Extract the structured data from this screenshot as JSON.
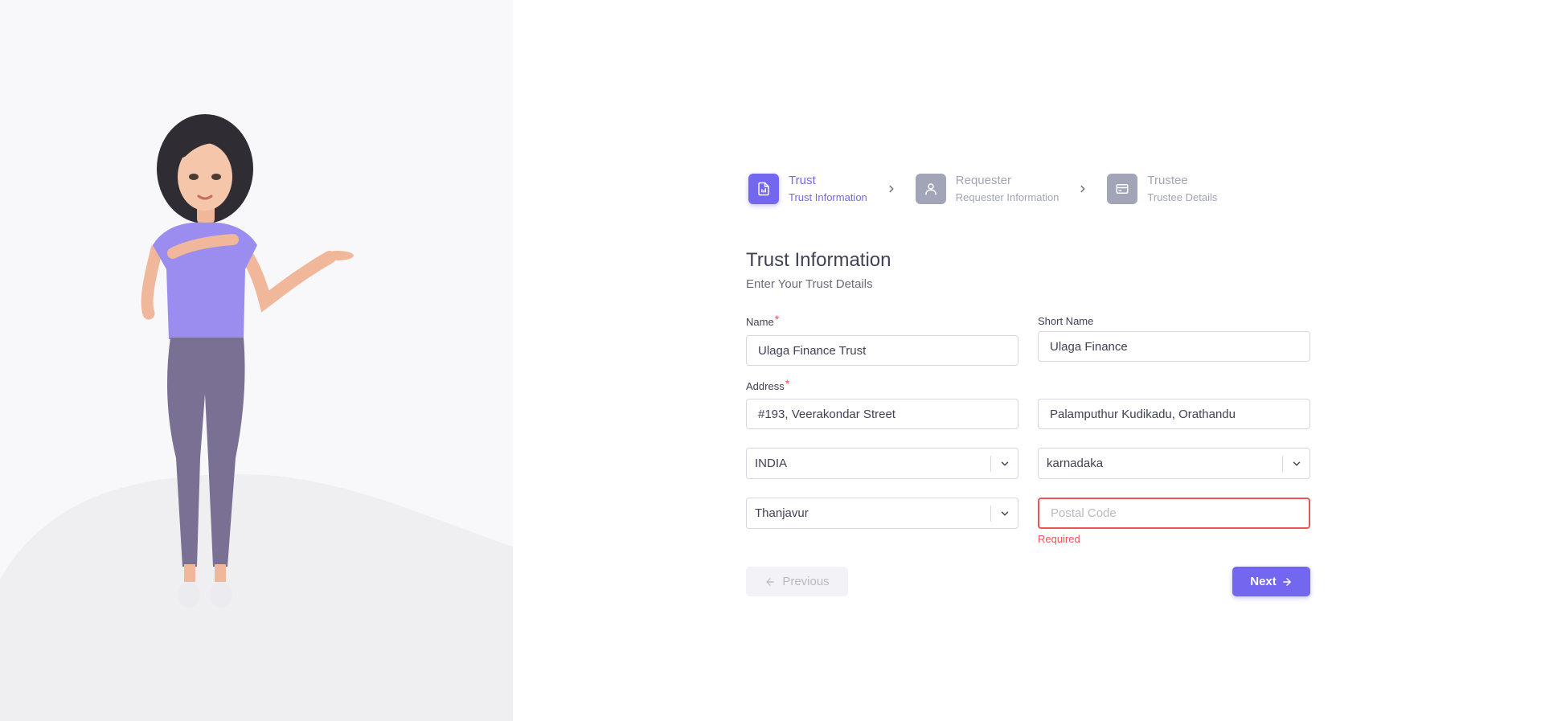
{
  "stepper": {
    "steps": [
      {
        "title": "Trust",
        "subtitle": "Trust Information",
        "icon": "file-icon",
        "active": true
      },
      {
        "title": "Requester",
        "subtitle": "Requester Information",
        "icon": "user-icon",
        "active": false
      },
      {
        "title": "Trustee",
        "subtitle": "Trustee Details",
        "icon": "card-icon",
        "active": false
      }
    ]
  },
  "form": {
    "title": "Trust Information",
    "subtitle": "Enter Your Trust Details",
    "name": {
      "label": "Name",
      "required_mark": "*",
      "value": "Ulaga Finance Trust"
    },
    "short_name": {
      "label": "Short Name",
      "value": "Ulaga Finance"
    },
    "address": {
      "label": "Address",
      "required_mark": "*",
      "line1": "#193, Veerakondar Street",
      "line2": "Palamputhur Kudikadu, Orathandu"
    },
    "country": {
      "value": "INDIA"
    },
    "state": {
      "value": "karnadaka"
    },
    "city": {
      "value": "Thanjavur"
    },
    "postal_code": {
      "placeholder": "Postal Code",
      "value": "",
      "error": "Required"
    }
  },
  "buttons": {
    "previous": "Previous",
    "next": "Next"
  },
  "colors": {
    "primary": "#7367f0",
    "error": "#ea5455",
    "muted": "#a1a5b7"
  }
}
